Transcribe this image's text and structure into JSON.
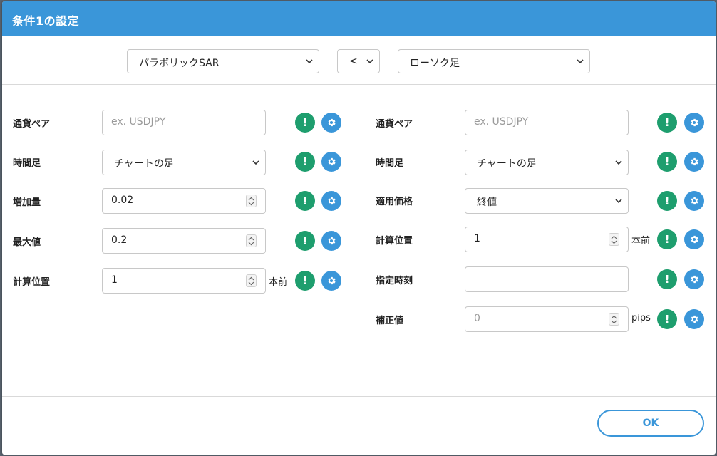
{
  "dialog": {
    "title": "条件1の設定",
    "header_color": "#3a96d9",
    "ok_label": "OK"
  },
  "top": {
    "left_indicator": "パラボリックSAR",
    "operator": "<",
    "right_indicator": "ローソク足"
  },
  "left": {
    "currency_pair": {
      "label": "通貨ペア",
      "placeholder": "ex. USDJPY",
      "value": ""
    },
    "timeframe": {
      "label": "時間足",
      "value": "チャートの足"
    },
    "increment": {
      "label": "増加量",
      "value": "0.02"
    },
    "max_value": {
      "label": "最大値",
      "value": "0.2"
    },
    "calc_position": {
      "label": "計算位置",
      "value": "1",
      "unit": "本前"
    }
  },
  "right": {
    "currency_pair": {
      "label": "通貨ペア",
      "placeholder": "ex. USDJPY",
      "value": ""
    },
    "timeframe": {
      "label": "時間足",
      "value": "チャートの足"
    },
    "applied_price": {
      "label": "適用価格",
      "value": "終値"
    },
    "calc_position": {
      "label": "計算位置",
      "value": "1",
      "unit": "本前"
    },
    "specified_time": {
      "label": "指定時刻",
      "value": ""
    },
    "correction": {
      "label": "補正値",
      "value": "0",
      "unit": "pips"
    }
  },
  "icons": {
    "alert": "exclamation-icon",
    "settings": "gear-icon",
    "alert_color": "#1e9e6e",
    "settings_color": "#3a96d9",
    "alert_glyph": "!"
  }
}
